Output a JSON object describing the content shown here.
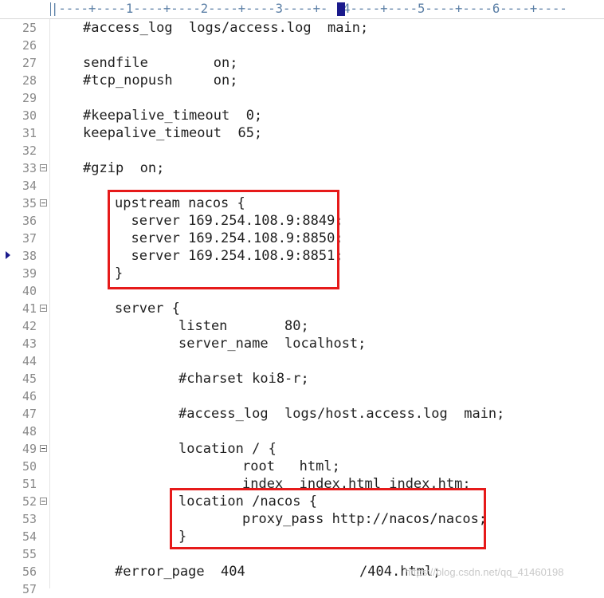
{
  "ruler": {
    "text": "|----+----1----+----2----+----3----+- -4----+----5----+----6----+----"
  },
  "lines": [
    {
      "num": "25",
      "text": "#access_log  logs/access.log  main;"
    },
    {
      "num": "26",
      "text": ""
    },
    {
      "num": "27",
      "text": "sendfile        on;"
    },
    {
      "num": "28",
      "text": "#tcp_nopush     on;"
    },
    {
      "num": "29",
      "text": ""
    },
    {
      "num": "30",
      "text": "#keepalive_timeout  0;"
    },
    {
      "num": "31",
      "text": "keepalive_timeout  65;"
    },
    {
      "num": "32",
      "text": ""
    },
    {
      "num": "33",
      "text": "#gzip  on;"
    },
    {
      "num": "34",
      "text": ""
    },
    {
      "num": "35",
      "text": "upstream nacos {"
    },
    {
      "num": "36",
      "text": "  server 169.254.108.9:8849;"
    },
    {
      "num": "37",
      "text": "  server 169.254.108.9:8850;"
    },
    {
      "num": "38",
      "text": "  server 169.254.108.9:8851;"
    },
    {
      "num": "39",
      "text": "}"
    },
    {
      "num": "40",
      "text": ""
    },
    {
      "num": "41",
      "text": "server {"
    },
    {
      "num": "42",
      "text": "listen       80;"
    },
    {
      "num": "43",
      "text": "server_name  localhost;"
    },
    {
      "num": "44",
      "text": ""
    },
    {
      "num": "45",
      "text": "#charset koi8-r;"
    },
    {
      "num": "46",
      "text": ""
    },
    {
      "num": "47",
      "text": "#access_log  logs/host.access.log  main;"
    },
    {
      "num": "48",
      "text": ""
    },
    {
      "num": "49",
      "text": "location / {"
    },
    {
      "num": "50",
      "text": "root   html;"
    },
    {
      "num": "51",
      "text": "index  index.html index.htm;"
    },
    {
      "num": "52",
      "text": "location /nacos {"
    },
    {
      "num": "53",
      "text": "proxy_pass http://nacos/nacos;"
    },
    {
      "num": "54",
      "text": "}"
    },
    {
      "num": "55",
      "text": ""
    },
    {
      "num": "56",
      "text": "#error_page  404              /404.html;"
    },
    {
      "num": "57",
      "text": ""
    }
  ],
  "colors": {
    "highlight_box": "#e61a1a",
    "line_numbers": "#8a8a8a",
    "code_text": "#1f1f1f",
    "ruler": "#5b7fa6",
    "current_line_marker": "#1a1a8c"
  },
  "watermark": "https://blog.csdn.net/qq_41460198"
}
